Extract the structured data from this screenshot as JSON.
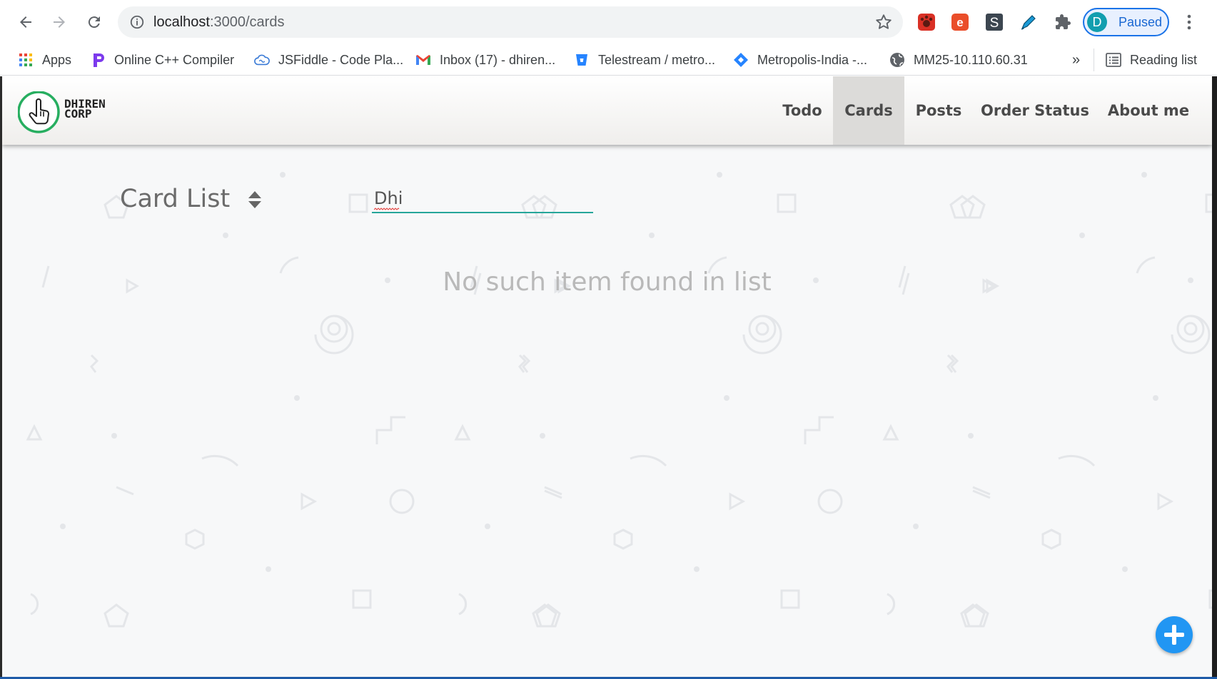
{
  "browser": {
    "url_scheme_host": "localhost",
    "url_path": ":3000/cards",
    "profile_initial": "D",
    "profile_status": "Paused",
    "bookmarks": [
      {
        "label": "Apps",
        "icon": "apps-grid-icon"
      },
      {
        "label": "Online C++ Compiler",
        "icon": "compiler-icon"
      },
      {
        "label": "JSFiddle - Code Pla...",
        "icon": "jsfiddle-cloud-icon"
      },
      {
        "label": "Inbox (17) - dhiren...",
        "icon": "gmail-icon"
      },
      {
        "label": "Telestream / metro...",
        "icon": "bitbucket-icon"
      },
      {
        "label": "Metropolis-India -...",
        "icon": "jira-diamond-icon"
      },
      {
        "label": "MM25-10.110.60.31",
        "icon": "globe-icon"
      }
    ],
    "overflow_label": "»",
    "reading_list_label": "Reading list"
  },
  "app": {
    "logo_text_line1": "DHIREN",
    "logo_text_line2": "CORP",
    "nav": [
      {
        "label": "Todo",
        "active": false
      },
      {
        "label": "Cards",
        "active": true
      },
      {
        "label": "Posts",
        "active": false
      },
      {
        "label": "Order Status",
        "active": false
      },
      {
        "label": "About me",
        "active": false
      }
    ],
    "page_title": "Card List",
    "search_value": "Dhi",
    "empty_message": "No such item found in list",
    "accent_color": "#26a69a",
    "fab_color": "#2196f3"
  }
}
